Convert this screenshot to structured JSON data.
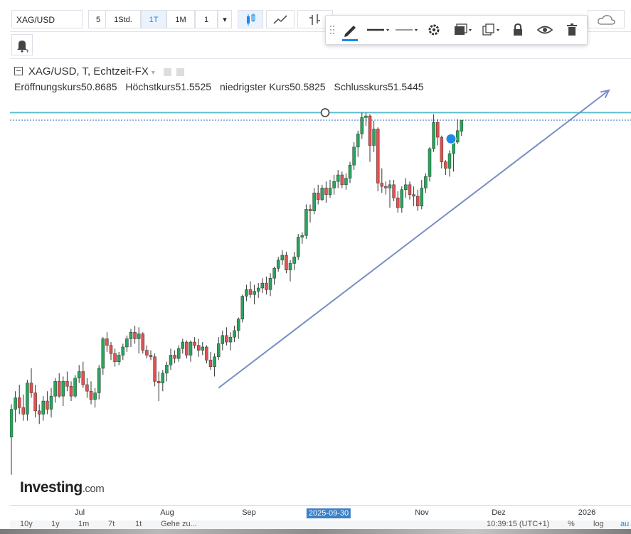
{
  "toolbar": {
    "symbol": "XAG/USD",
    "intervals": [
      "5",
      "1Std.",
      "1T",
      "1M",
      "1"
    ],
    "active_interval": "1T"
  },
  "float_toolbar": {
    "icons": [
      "pencil-icon",
      "line-style-icon",
      "line-width-icon",
      "settings-icon",
      "fill-icon",
      "clone-icon",
      "lock-icon",
      "eye-icon",
      "trash-icon"
    ],
    "accent": "#1e88e5"
  },
  "legend": {
    "title": "XAG/USD, T, Echtzeit-FX",
    "open_label": "Eröffnungskurs",
    "open": "50.8685",
    "high_label": "Höchstkurs",
    "high": "51.5525",
    "low_label": "niedrigster Kurs",
    "low": "50.5825",
    "close_label": "Schlusskurs",
    "close": "51.5445"
  },
  "x_axis": {
    "ticks": [
      "Jul",
      "Aug",
      "Sep",
      "2025-09-30",
      "Nov",
      "Dez",
      "2026"
    ],
    "highlight": "2025-09-30"
  },
  "range_bar": {
    "items": [
      "10y",
      "1y",
      "1m",
      "7t",
      "1t",
      "Gehe zu..."
    ],
    "time": "10:39:15 (UTC+1)",
    "right": [
      "%",
      "log",
      "au"
    ]
  },
  "logo": {
    "main": "Investing",
    "suffix": ".com"
  },
  "colors": {
    "up": "#26a65b",
    "down": "#e3504f",
    "trendline": "#7a8fc4",
    "hline": "#5bbfcf",
    "price_line": "#2e66b3"
  },
  "chart_data": {
    "type": "candlestick",
    "title": "XAG/USD, T, Echtzeit-FX",
    "x_unit": "trading day index",
    "ylim": [
      28.5,
      52.8
    ],
    "candles": [
      [
        32.2,
        34.2,
        29.9,
        33.9
      ],
      [
        33.9,
        35.0,
        33.1,
        34.6
      ],
      [
        34.6,
        35.4,
        33.6,
        34.0
      ],
      [
        34.0,
        34.8,
        33.2,
        33.6
      ],
      [
        33.6,
        35.7,
        33.2,
        35.5
      ],
      [
        35.5,
        36.4,
        34.6,
        34.9
      ],
      [
        34.9,
        35.4,
        33.4,
        33.8
      ],
      [
        33.8,
        34.2,
        33.0,
        33.6
      ],
      [
        33.6,
        34.7,
        33.2,
        34.4
      ],
      [
        34.4,
        35.0,
        33.6,
        33.9
      ],
      [
        33.9,
        35.2,
        33.4,
        34.7
      ],
      [
        34.7,
        35.8,
        34.3,
        35.6
      ],
      [
        35.6,
        36.1,
        34.6,
        34.7
      ],
      [
        34.7,
        35.9,
        34.1,
        35.6
      ],
      [
        35.6,
        36.2,
        35.0,
        35.3
      ],
      [
        35.3,
        35.6,
        34.4,
        34.7
      ],
      [
        34.7,
        36.0,
        34.6,
        35.8
      ],
      [
        35.8,
        36.6,
        35.5,
        36.2
      ],
      [
        36.2,
        36.8,
        35.2,
        35.4
      ],
      [
        35.4,
        35.8,
        34.6,
        35.0
      ],
      [
        35.0,
        35.6,
        34.2,
        34.5
      ],
      [
        34.5,
        35.2,
        34.0,
        34.9
      ],
      [
        34.9,
        36.6,
        34.5,
        36.4
      ],
      [
        36.4,
        38.3,
        36.0,
        38.2
      ],
      [
        38.2,
        38.6,
        37.4,
        37.8
      ],
      [
        37.8,
        38.0,
        36.9,
        37.3
      ],
      [
        37.3,
        37.6,
        36.5,
        36.8
      ],
      [
        36.8,
        37.4,
        36.6,
        37.2
      ],
      [
        37.2,
        37.9,
        36.9,
        37.7
      ],
      [
        37.7,
        38.4,
        37.4,
        38.2
      ],
      [
        38.2,
        38.8,
        37.7,
        38.6
      ],
      [
        38.6,
        39.0,
        37.9,
        38.2
      ],
      [
        38.2,
        38.9,
        37.3,
        38.5
      ],
      [
        38.5,
        38.6,
        37.3,
        37.5
      ],
      [
        37.5,
        37.8,
        37.0,
        37.2
      ],
      [
        37.2,
        37.5,
        36.9,
        37.1
      ],
      [
        37.1,
        37.3,
        35.3,
        35.6
      ],
      [
        35.6,
        36.2,
        34.4,
        35.5
      ],
      [
        35.5,
        36.3,
        35.0,
        36.1
      ],
      [
        36.1,
        36.8,
        35.6,
        36.6
      ],
      [
        36.6,
        37.6,
        36.3,
        37.2
      ],
      [
        37.2,
        37.5,
        36.7,
        37.0
      ],
      [
        37.0,
        37.8,
        36.8,
        37.6
      ],
      [
        37.6,
        38.2,
        37.3,
        38.0
      ],
      [
        38.0,
        38.1,
        37.0,
        37.2
      ],
      [
        37.2,
        38.1,
        36.8,
        38.0
      ],
      [
        38.0,
        38.3,
        37.6,
        37.8
      ],
      [
        37.8,
        38.2,
        37.1,
        37.5
      ],
      [
        37.5,
        38.0,
        37.2,
        37.7
      ],
      [
        37.7,
        37.8,
        36.7,
        36.9
      ],
      [
        36.9,
        37.4,
        36.3,
        36.5
      ],
      [
        36.5,
        37.3,
        35.9,
        37.1
      ],
      [
        37.1,
        38.3,
        36.9,
        37.9
      ],
      [
        37.9,
        38.7,
        37.5,
        38.4
      ],
      [
        38.4,
        38.9,
        37.8,
        38.0
      ],
      [
        38.0,
        38.6,
        37.5,
        38.3
      ],
      [
        38.3,
        39.0,
        38.0,
        38.7
      ],
      [
        38.7,
        39.5,
        38.2,
        39.4
      ],
      [
        39.4,
        40.9,
        39.2,
        40.8
      ],
      [
        40.8,
        41.5,
        40.5,
        41.2
      ],
      [
        41.2,
        41.7,
        40.7,
        40.9
      ],
      [
        40.9,
        41.5,
        40.3,
        41.1
      ],
      [
        41.1,
        41.6,
        40.7,
        41.3
      ],
      [
        41.3,
        41.9,
        41.0,
        41.6
      ],
      [
        41.6,
        42.0,
        40.9,
        41.2
      ],
      [
        41.2,
        42.2,
        40.8,
        41.9
      ],
      [
        41.9,
        42.6,
        41.5,
        42.5
      ],
      [
        42.5,
        43.2,
        42.3,
        43.0
      ],
      [
        43.0,
        43.6,
        42.7,
        43.3
      ],
      [
        43.3,
        43.5,
        42.2,
        42.4
      ],
      [
        42.4,
        43.0,
        41.7,
        42.8
      ],
      [
        42.8,
        43.5,
        42.4,
        43.2
      ],
      [
        43.2,
        44.6,
        43.0,
        44.4
      ],
      [
        44.4,
        44.7,
        44.0,
        44.5
      ],
      [
        44.5,
        46.4,
        44.3,
        46.1
      ],
      [
        46.1,
        46.4,
        45.3,
        46.0
      ],
      [
        46.0,
        47.4,
        45.8,
        47.1
      ],
      [
        47.1,
        47.6,
        46.4,
        46.7
      ],
      [
        46.7,
        47.6,
        46.6,
        47.4
      ],
      [
        47.4,
        47.8,
        46.5,
        47.0
      ],
      [
        47.0,
        47.9,
        46.8,
        47.4
      ],
      [
        47.4,
        48.2,
        47.0,
        47.8
      ],
      [
        47.8,
        48.5,
        47.4,
        48.2
      ],
      [
        48.2,
        48.4,
        47.4,
        47.6
      ],
      [
        47.6,
        48.3,
        47.3,
        48.0
      ],
      [
        48.0,
        49.0,
        47.7,
        48.8
      ],
      [
        48.8,
        50.2,
        48.5,
        49.9
      ],
      [
        49.9,
        50.9,
        49.3,
        50.7
      ],
      [
        50.7,
        52.0,
        50.4,
        51.7
      ],
      [
        51.7,
        52.0,
        51.2,
        51.8
      ],
      [
        51.8,
        51.9,
        49.0,
        50.0
      ],
      [
        50.0,
        51.5,
        49.6,
        51.0
      ],
      [
        51.0,
        51.1,
        47.2,
        47.7
      ],
      [
        47.7,
        48.6,
        47.1,
        47.5
      ],
      [
        47.5,
        47.8,
        47.0,
        47.4
      ],
      [
        47.4,
        47.9,
        46.2,
        47.6
      ],
      [
        47.6,
        47.9,
        46.6,
        46.8
      ],
      [
        46.8,
        47.2,
        45.9,
        46.2
      ],
      [
        46.2,
        47.5,
        45.9,
        47.3
      ],
      [
        47.3,
        48.0,
        46.8,
        47.6
      ],
      [
        47.6,
        47.8,
        46.7,
        47.0
      ],
      [
        47.0,
        47.5,
        46.3,
        46.9
      ],
      [
        46.9,
        47.3,
        46.0,
        46.3
      ],
      [
        46.3,
        47.9,
        46.1,
        47.4
      ],
      [
        47.4,
        48.3,
        47.1,
        48.1
      ],
      [
        48.1,
        49.9,
        47.8,
        49.8
      ],
      [
        49.8,
        51.9,
        49.6,
        51.4
      ],
      [
        51.4,
        51.6,
        50.0,
        50.5
      ],
      [
        50.5,
        50.6,
        48.6,
        49.0
      ],
      [
        49.0,
        49.1,
        48.2,
        48.6
      ],
      [
        48.6,
        49.7,
        48.1,
        49.5
      ],
      [
        49.5,
        50.6,
        48.4,
        50.2
      ],
      [
        50.2,
        51.6,
        50.1,
        50.9
      ],
      [
        50.87,
        51.55,
        50.58,
        51.54
      ]
    ]
  }
}
